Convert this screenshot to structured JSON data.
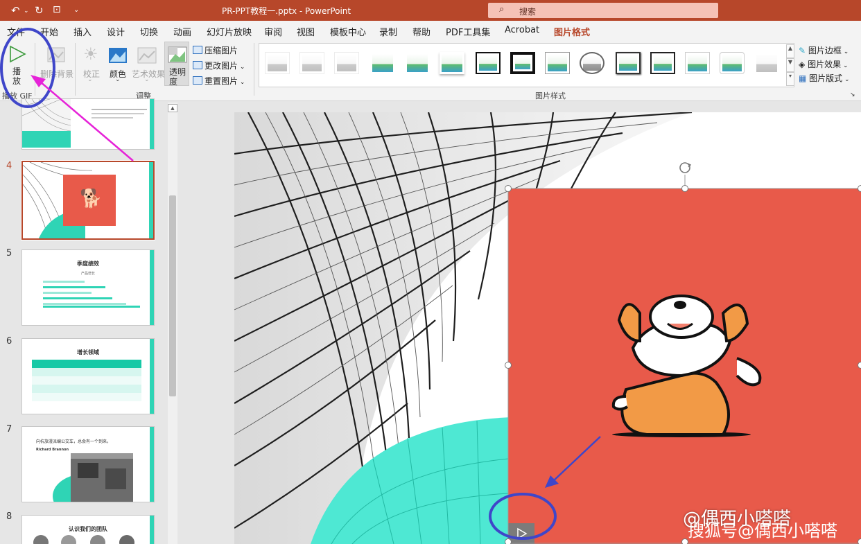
{
  "titlebar": {
    "doc_title": "PR-PPT教程一.pptx  -  PowerPoint",
    "search_placeholder": "搜索",
    "undo_icon": "undo-icon",
    "redo_icon": "redo-icon",
    "present_icon": "present-icon"
  },
  "tabs": [
    {
      "label": "文件"
    },
    {
      "label": "开始"
    },
    {
      "label": "插入"
    },
    {
      "label": "设计"
    },
    {
      "label": "切换"
    },
    {
      "label": "动画"
    },
    {
      "label": "幻灯片放映"
    },
    {
      "label": "审阅"
    },
    {
      "label": "视图"
    },
    {
      "label": "模板中心"
    },
    {
      "label": "录制"
    },
    {
      "label": "帮助"
    },
    {
      "label": "PDF工具集"
    },
    {
      "label": "Acrobat"
    },
    {
      "label": "图片格式"
    }
  ],
  "ribbon": {
    "play_gif": {
      "label_line1": "播",
      "label_line2": "放",
      "group": "播放 GIF"
    },
    "remove_bg": "删除背景",
    "corrections": "校正",
    "color": "颜色",
    "artistic": "艺术效果",
    "transparency_line1": "透明",
    "transparency_line2": "度",
    "compress": "压缩图片",
    "change": "更改图片",
    "reset": "重置图片",
    "adjust_group": "调整",
    "styles_group": "图片样式",
    "border": "图片边框",
    "effects": "图片效果",
    "layout": "图片版式"
  },
  "slides": {
    "numbers": [
      "4",
      "5",
      "6",
      "7",
      "8"
    ],
    "slide5_title": "季度绩效",
    "slide5_subtitle": "产品增长",
    "slide6_title": "增长领域",
    "slide7_quote": "向杭旅漫派编公交车，总会有一个到来。",
    "slide7_author": "Richard Brannon",
    "slide8_title": "认识我们的团队"
  },
  "watermark": {
    "line1": "@偶西小嗒嗒",
    "line2": "搜狐号@偶西小嗒嗒"
  },
  "colors": {
    "accent": "#b7472a",
    "teal": "#2fd4b5",
    "picture_bg": "#e85a4a",
    "annotation_blue": "#3f46c9",
    "annotation_magenta": "#e623d8"
  }
}
